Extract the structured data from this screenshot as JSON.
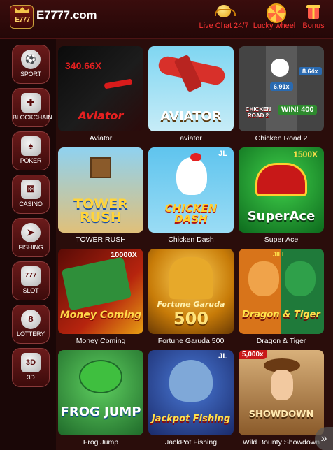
{
  "header": {
    "logo_badge": "E777",
    "logo_text": "E7777.com",
    "buttons": [
      {
        "label": "Live Chat 24/7",
        "icon": "headset-icon"
      },
      {
        "label": "Lucky wheel",
        "icon": "wheel-icon"
      },
      {
        "label": "Bonus",
        "icon": "gift-icon"
      }
    ]
  },
  "sidebar": {
    "items": [
      {
        "label": "SPORT",
        "icon": "soccer-ball-icon"
      },
      {
        "label": "BLOCKCHAIN",
        "icon": "gamepad-icon"
      },
      {
        "label": "POKER",
        "icon": "cards-icon"
      },
      {
        "label": "CASINO",
        "icon": "dice-icon"
      },
      {
        "label": "FISHING",
        "icon": "fish-icon"
      },
      {
        "label": "SLOT",
        "icon": "slot-777-icon",
        "glyph": "777"
      },
      {
        "label": "LOTTERY",
        "icon": "lottery-ball-icon",
        "glyph": "8"
      },
      {
        "label": "3D",
        "icon": "3d-icon",
        "glyph": "3D"
      }
    ]
  },
  "games": [
    {
      "name": "Aviator",
      "overlay": "340.66X",
      "title": "Aviator"
    },
    {
      "name": "aviator",
      "title": "AVIATOR"
    },
    {
      "name": "Chicken Road 2",
      "title": "CHICKEN ROAD 2",
      "badge": "WIN! 400",
      "chip": "6.91x",
      "chip2": "8.64x"
    },
    {
      "name": "TOWER RUSH",
      "title": "TOWER RUSH"
    },
    {
      "name": "Chicken Dash",
      "title": "CHICKEN DASH",
      "badge": "JL"
    },
    {
      "name": "Super Ace",
      "title": "SuperAce",
      "badge": "1500X"
    },
    {
      "name": "Money Coming",
      "title": "Money Coming",
      "badge": "10000X"
    },
    {
      "name": "Fortune Garuda 500",
      "title": "500",
      "subtitle": "Fortune Garuda"
    },
    {
      "name": "Dragon & Tiger",
      "title": "Dragon & Tiger",
      "badge": "JILI"
    },
    {
      "name": "Frog Jump",
      "title": "FROG JUMP"
    },
    {
      "name": "JackPot Fishing",
      "title": "Jackpot Fishing",
      "badge": "JL"
    },
    {
      "name": "Wild Bounty Showdown",
      "title": "SHOWDOWN",
      "badge": "5,000x"
    }
  ],
  "colors": {
    "accent": "#ff3434",
    "sidebar_tile": "#6b1b1b",
    "background": "#2a0d0b"
  }
}
